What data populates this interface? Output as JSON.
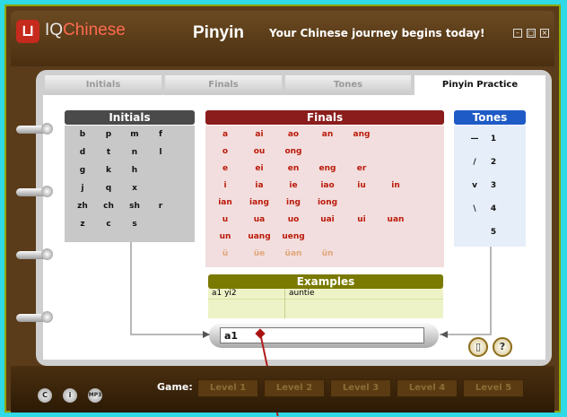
{
  "logo": {
    "brand_prefix": "IQ",
    "brand_suffix": "Chinese",
    "icon": "stamp-icon"
  },
  "header": {
    "title": "Pinyin",
    "subtitle": "Your Chinese journey begins today!"
  },
  "tabs": [
    {
      "label": "Initials"
    },
    {
      "label": "Finals"
    },
    {
      "label": "Tones"
    },
    {
      "label": "Pinyin Practice"
    }
  ],
  "initials": {
    "title": "Initials",
    "rows": [
      [
        "b",
        "p",
        "m",
        "f"
      ],
      [
        "d",
        "t",
        "n",
        "l"
      ],
      [
        "g",
        "k",
        "h",
        ""
      ],
      [
        "j",
        "q",
        "x",
        ""
      ],
      [
        "zh",
        "ch",
        "sh",
        "r"
      ],
      [
        "z",
        "c",
        "s",
        ""
      ]
    ]
  },
  "finals": {
    "title": "Finals",
    "rows": [
      [
        "a",
        "ai",
        "ao",
        "an",
        "ang",
        "",
        ""
      ],
      [
        "o",
        "ou",
        "ong",
        "",
        "",
        "",
        ""
      ],
      [
        "e",
        "ei",
        "en",
        "eng",
        "er",
        "",
        ""
      ],
      [
        "i",
        "ia",
        "ie",
        "iao",
        "iu",
        "in",
        ""
      ],
      [
        "ian",
        "iang",
        "ing",
        "iong",
        "",
        "",
        ""
      ],
      [
        "u",
        "ua",
        "uo",
        "uai",
        "ui",
        "uan",
        ""
      ],
      [
        "un",
        "uang",
        "ueng",
        "",
        "",
        "",
        ""
      ],
      [
        "ü",
        "üe",
        "üan",
        "ün",
        "",
        "",
        ""
      ]
    ]
  },
  "tones": {
    "title": "Tones",
    "items": [
      {
        "mark": "—",
        "num": "1"
      },
      {
        "mark": "/",
        "num": "2"
      },
      {
        "mark": "v",
        "num": "3"
      },
      {
        "mark": "\\",
        "num": "4"
      },
      {
        "mark": "",
        "num": "5"
      }
    ]
  },
  "examples": {
    "title": "Examples",
    "rows": [
      {
        "pinyin": "a1 yi2",
        "meaning": "auntie"
      }
    ]
  },
  "input": {
    "value": "a1"
  },
  "bottom": {
    "buttons": [
      "C",
      "i",
      "MP3"
    ],
    "game_label": "Game:",
    "levels": [
      "Level 1",
      "Level 2",
      "Level 3",
      "Level 4",
      "Level 5"
    ]
  },
  "colors": {
    "background": "#2fd9e6",
    "finals_header": "#8b1d1d",
    "examples_header": "#7a7a00",
    "tones_header": "#1f5bc6"
  }
}
